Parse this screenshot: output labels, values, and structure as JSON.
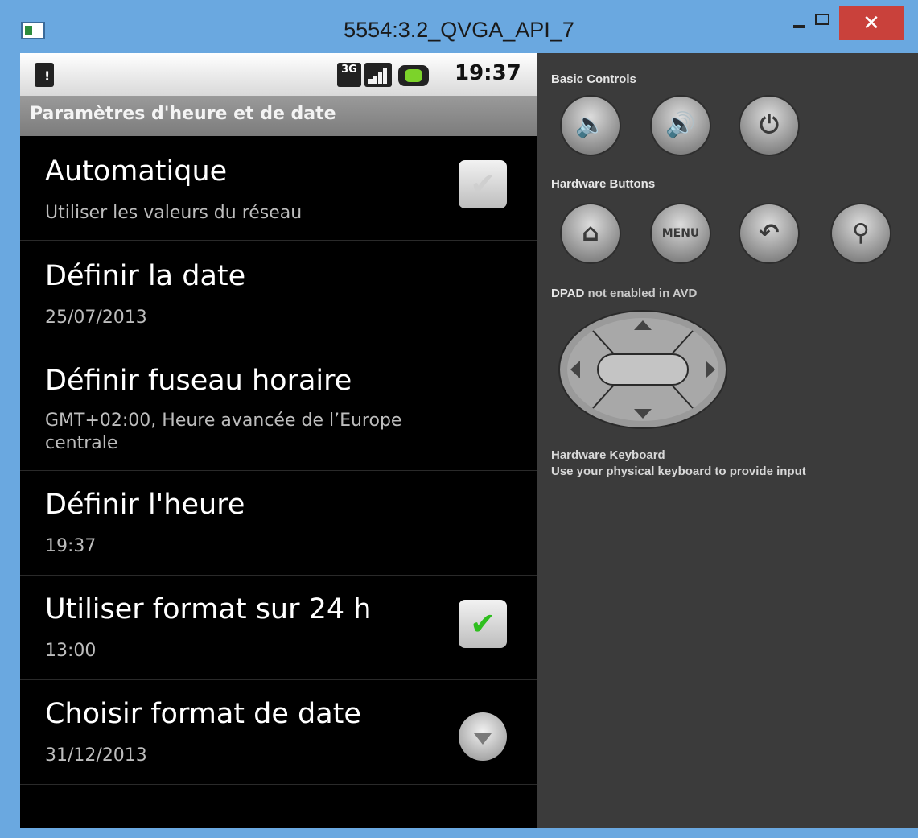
{
  "window": {
    "title": "5554:3.2_QVGA_API_7",
    "close_glyph": "✕",
    "accent_color": "#6aa8e0",
    "close_color": "#c9413b"
  },
  "statusbar": {
    "network_label": "3G",
    "time": "19:37"
  },
  "screen": {
    "title": "Paramètres d'heure et de date"
  },
  "preferences": [
    {
      "title": "Automatique",
      "summary": "Utiliser les valeurs du réseau",
      "widget": "checkbox",
      "checked": true,
      "enabled": false
    },
    {
      "title": "Définir la date",
      "summary": "25/07/2013"
    },
    {
      "title": "Définir fuseau horaire",
      "summary": "GMT+02:00, Heure avancée de l’Europe centrale"
    },
    {
      "title": "Définir l'heure",
      "summary": "19:37"
    },
    {
      "title": "Utiliser format sur 24 h",
      "summary": "13:00",
      "widget": "checkbox",
      "checked": true,
      "enabled": true
    },
    {
      "title": "Choisir format de date",
      "summary": "31/12/2013",
      "widget": "dropdown"
    }
  ],
  "controls": {
    "basic_label": "Basic Controls",
    "hardware_label": "Hardware Buttons",
    "menu_label": "MENU",
    "dpad_label_strong": "DPAD",
    "dpad_label_rest": " not enabled in AVD",
    "keyboard_title": "Hardware Keyboard",
    "keyboard_desc": "Use your physical keyboard to provide input"
  }
}
